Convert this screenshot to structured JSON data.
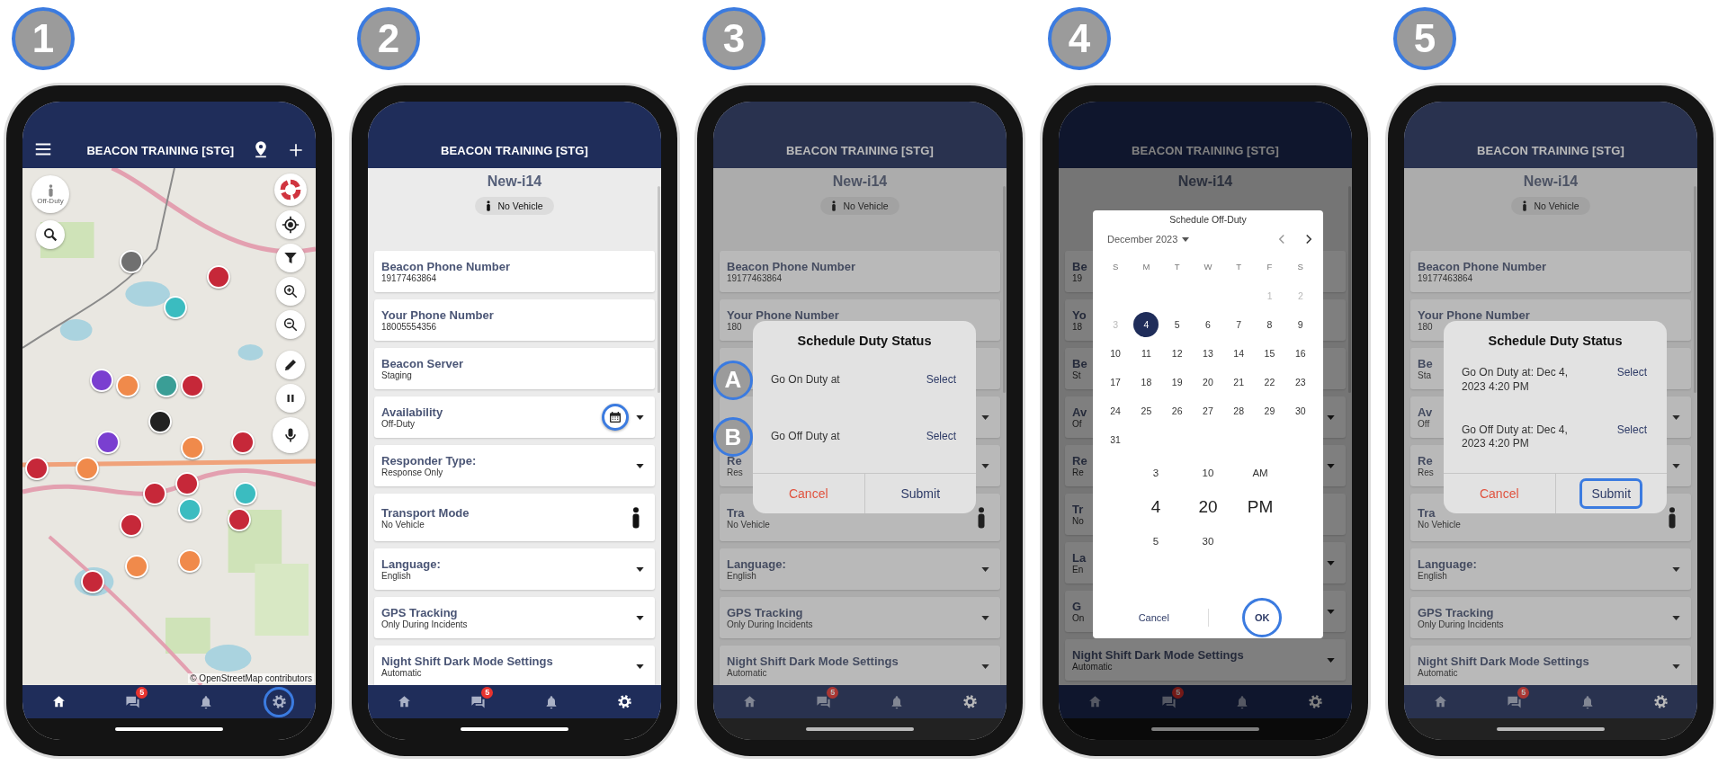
{
  "steps": [
    {
      "number": "1",
      "screen": {
        "kind": "map",
        "header": {
          "title": "BEACON TRAINING [STG]"
        },
        "duty_button": {
          "label": "Off-Duty"
        },
        "markers": [
          {
            "color": "#707070"
          },
          {
            "color": "#c62839"
          },
          {
            "color": "#3bbcc0"
          },
          {
            "color": "#7a3fd0"
          },
          {
            "color": "#f08a4b"
          },
          {
            "color": "#3a9e96"
          },
          {
            "color": "#c62839"
          },
          {
            "color": "#222222"
          },
          {
            "color": "#7a3fd0"
          },
          {
            "color": "#f08a4b"
          },
          {
            "color": "#c62839"
          },
          {
            "color": "#c62839"
          },
          {
            "color": "#f08a4b"
          },
          {
            "color": "#c62839"
          },
          {
            "color": "#c62839"
          },
          {
            "color": "#3bbcc0"
          },
          {
            "color": "#3bbcc0"
          },
          {
            "color": "#c62839"
          },
          {
            "color": "#c62839"
          },
          {
            "color": "#f08a4b"
          },
          {
            "color": "#f08a4b"
          },
          {
            "color": "#c62839"
          }
        ],
        "attribution": "© OpenStreetMap contributors",
        "nav": [
          {
            "kind": "home",
            "selected": true,
            "highlighted": false
          },
          {
            "kind": "chat",
            "badge": "5",
            "selected": false,
            "highlighted": false
          },
          {
            "kind": "bell",
            "selected": false,
            "highlighted": false
          },
          {
            "kind": "gear",
            "selected": false,
            "highlighted": true
          }
        ]
      }
    },
    {
      "number": "2",
      "screen": {
        "kind": "settings",
        "header": {
          "title": "BEACON TRAINING [STG]"
        },
        "device": {
          "name": "New-i14",
          "chip": "No Vehicle"
        },
        "items": [
          {
            "title": "Beacon Phone Number",
            "value": "19177463864",
            "kind": "plain"
          },
          {
            "title": "Your Phone Number",
            "value": "18005554356",
            "kind": "plain"
          },
          {
            "title": "Beacon Server",
            "value": "Staging",
            "kind": "plain"
          },
          {
            "title": "Availability",
            "value": "Off-Duty",
            "kind": "calendar",
            "highlighted": true
          },
          {
            "title": "Responder Type:",
            "value": "Response Only",
            "kind": "caret"
          },
          {
            "title": "Transport Mode",
            "value": "No Vehicle",
            "kind": "person"
          },
          {
            "title": "Language:",
            "value": "English",
            "kind": "caret"
          },
          {
            "title": "GPS Tracking",
            "value": "Only During Incidents",
            "kind": "caret"
          },
          {
            "title": "Night Shift Dark Mode Settings",
            "value": "Automatic",
            "kind": "caret"
          }
        ],
        "nav": [
          {
            "kind": "home",
            "selected": false,
            "highlighted": false
          },
          {
            "kind": "chat",
            "badge": "5",
            "selected": false,
            "highlighted": false
          },
          {
            "kind": "bell",
            "selected": false,
            "highlighted": false
          },
          {
            "kind": "gear",
            "selected": true,
            "highlighted": false
          }
        ]
      }
    },
    {
      "number": "3",
      "screen": {
        "kind": "settings",
        "header": {
          "title": "BEACON TRAINING [STG]"
        },
        "device": {
          "name": "New-i14",
          "chip": "No Vehicle"
        },
        "items": [
          {
            "title": "Beacon Phone Number",
            "value": "19177463864",
            "kind": "plain"
          },
          {
            "title": "Your Phone Number",
            "value": "180",
            "kind": "plain"
          },
          {
            "kind": "plain"
          },
          {
            "kind": "caret"
          },
          {
            "title": "Re",
            "value": "Res",
            "kind": "caret"
          },
          {
            "title": "Tra",
            "value": "No Vehicle",
            "kind": "person"
          },
          {
            "title": "Language:",
            "value": "English",
            "kind": "caret"
          },
          {
            "title": "GPS Tracking",
            "value": "Only During Incidents",
            "kind": "caret"
          },
          {
            "title": "Night Shift Dark Mode Settings",
            "value": "Automatic",
            "kind": "caret"
          }
        ],
        "dialog": {
          "kind": "schedule",
          "title": "Schedule Duty Status",
          "rows": [
            {
              "label": "Go On Duty at",
              "action": "Select",
              "marker": "A"
            },
            {
              "label": "Go Off Duty at",
              "action": "Select",
              "marker": "B"
            }
          ],
          "buttons": [
            {
              "label": "Cancel",
              "kind": "cancel",
              "highlighted": false
            },
            {
              "label": "Submit",
              "kind": "submit",
              "highlighted": false
            }
          ]
        },
        "nav": [
          {
            "kind": "home",
            "selected": false,
            "highlighted": false
          },
          {
            "kind": "chat",
            "badge": "5",
            "selected": false,
            "highlighted": false
          },
          {
            "kind": "bell",
            "selected": false,
            "highlighted": false
          },
          {
            "kind": "gear",
            "selected": true,
            "highlighted": false
          }
        ]
      }
    },
    {
      "number": "4",
      "screen": {
        "kind": "settings",
        "header": {
          "title": "BEACON TRAINING [STG]"
        },
        "device": {
          "name": "New-i14"
        },
        "items": [
          {
            "title": "Be",
            "value": "19",
            "kind": "plain"
          },
          {
            "title": "Yo",
            "value": "18",
            "kind": "plain"
          },
          {
            "title": "Be",
            "value": "St",
            "kind": "plain"
          },
          {
            "title": "Av",
            "value": "Of",
            "kind": "caret"
          },
          {
            "title": "Re",
            "value": "Re",
            "kind": "caret"
          },
          {
            "title": "Tr",
            "value": "No",
            "kind": "plain"
          },
          {
            "title": "La",
            "value": "En",
            "kind": "caret"
          },
          {
            "title": "G",
            "value": "On",
            "kind": "caret"
          },
          {
            "title": "Night Shift Dark Mode Settings",
            "value": "Automatic",
            "kind": "caret"
          }
        ],
        "dialog": {
          "kind": "date_picker",
          "title": "Schedule Off-Duty",
          "month": "December 2023",
          "weekdays": [
            "S",
            "M",
            "T",
            "W",
            "T",
            "F",
            "S"
          ],
          "weeks": [
            {
              "days": [
                {
                  "label": "1",
                  "selected": false,
                  "disabled": true
                },
                {
                  "label": "2",
                  "selected": false,
                  "disabled": true
                }
              ]
            },
            {
              "days": [
                {
                  "label": "3",
                  "selected": false,
                  "disabled": true
                },
                {
                  "label": "4",
                  "selected": true,
                  "disabled": false
                },
                {
                  "label": "5",
                  "selected": false,
                  "disabled": false
                },
                {
                  "label": "6",
                  "selected": false,
                  "disabled": false
                },
                {
                  "label": "7",
                  "selected": false,
                  "disabled": false
                },
                {
                  "label": "8",
                  "selected": false,
                  "disabled": false
                },
                {
                  "label": "9",
                  "selected": false,
                  "disabled": false
                }
              ]
            },
            {
              "days": [
                {
                  "label": "10",
                  "selected": false,
                  "disabled": false
                },
                {
                  "label": "11",
                  "selected": false,
                  "disabled": false
                },
                {
                  "label": "12",
                  "selected": false,
                  "disabled": false
                },
                {
                  "label": "13",
                  "selected": false,
                  "disabled": false
                },
                {
                  "label": "14",
                  "selected": false,
                  "disabled": false
                },
                {
                  "label": "15",
                  "selected": false,
                  "disabled": false
                },
                {
                  "label": "16",
                  "selected": false,
                  "disabled": false
                }
              ]
            },
            {
              "days": [
                {
                  "label": "17",
                  "selected": false,
                  "disabled": false
                },
                {
                  "label": "18",
                  "selected": false,
                  "disabled": false
                },
                {
                  "label": "19",
                  "selected": false,
                  "disabled": false
                },
                {
                  "label": "20",
                  "selected": false,
                  "disabled": false
                },
                {
                  "label": "21",
                  "selected": false,
                  "disabled": false
                },
                {
                  "label": "22",
                  "selected": false,
                  "disabled": false
                },
                {
                  "label": "23",
                  "selected": false,
                  "disabled": false
                }
              ]
            },
            {
              "days": [
                {
                  "label": "24",
                  "selected": false,
                  "disabled": false
                },
                {
                  "label": "25",
                  "selected": false,
                  "disabled": false
                },
                {
                  "label": "26",
                  "selected": false,
                  "disabled": false
                },
                {
                  "label": "27",
                  "selected": false,
                  "disabled": false
                },
                {
                  "label": "28",
                  "selected": false,
                  "disabled": false
                },
                {
                  "label": "29",
                  "selected": false,
                  "disabled": false
                },
                {
                  "label": "30",
                  "selected": false,
                  "disabled": false
                }
              ]
            },
            {
              "days": [
                {
                  "label": "31",
                  "selected": false,
                  "disabled": false
                }
              ]
            }
          ],
          "wheels": [
            {
              "options": [
                {
                  "label": "3",
                  "selected": false
                },
                {
                  "label": "4",
                  "selected": true
                },
                {
                  "label": "5",
                  "selected": false
                }
              ]
            },
            {
              "options": [
                {
                  "label": "10",
                  "selected": false
                },
                {
                  "label": "20",
                  "selected": true
                },
                {
                  "label": "30",
                  "selected": false
                }
              ]
            },
            {
              "options": [
                {
                  "label": "AM",
                  "selected": false
                },
                {
                  "label": "PM",
                  "selected": true
                }
              ]
            }
          ],
          "buttons": [
            {
              "label": "Cancel",
              "kind": "cancel",
              "highlighted": false
            },
            {
              "label": "OK",
              "kind": "submit",
              "highlighted": true
            }
          ]
        },
        "nav": [
          {
            "kind": "home",
            "selected": false,
            "highlighted": false
          },
          {
            "kind": "chat",
            "badge": "5",
            "selected": false,
            "highlighted": false
          },
          {
            "kind": "bell",
            "selected": false,
            "highlighted": false
          },
          {
            "kind": "gear",
            "selected": true,
            "highlighted": false
          }
        ]
      }
    },
    {
      "number": "5",
      "screen": {
        "kind": "settings",
        "header": {
          "title": "BEACON TRAINING [STG]"
        },
        "device": {
          "name": "New-i14",
          "chip": "No Vehicle"
        },
        "items": [
          {
            "title": "Beacon Phone Number",
            "value": "19177463864",
            "kind": "plain"
          },
          {
            "title": "Your Phone Number",
            "value": "180",
            "kind": "plain"
          },
          {
            "title": "Be",
            "value": "Sta",
            "kind": "plain"
          },
          {
            "title": "Av",
            "value": "Off",
            "kind": "caret"
          },
          {
            "title": "Re",
            "value": "Res",
            "kind": "caret"
          },
          {
            "title": "Tra",
            "value": "No Vehicle",
            "kind": "person"
          },
          {
            "title": "Language:",
            "value": "English",
            "kind": "caret"
          },
          {
            "title": "GPS Tracking",
            "value": "Only During Incidents",
            "kind": "caret"
          },
          {
            "title": "Night Shift Dark Mode Settings",
            "value": "Automatic",
            "kind": "caret"
          }
        ],
        "dialog": {
          "kind": "schedule",
          "title": "Schedule Duty Status",
          "rows": [
            {
              "label": "Go On Duty at: Dec 4, 2023 4:20 PM",
              "action": "Select"
            },
            {
              "label": "Go Off Duty at: Dec 4, 2023 4:20 PM",
              "action": "Select"
            }
          ],
          "buttons": [
            {
              "label": "Cancel",
              "kind": "cancel",
              "highlighted": false
            },
            {
              "label": "Submit",
              "kind": "submit",
              "highlighted": true
            }
          ]
        },
        "nav": [
          {
            "kind": "home",
            "selected": false,
            "highlighted": false
          },
          {
            "kind": "chat",
            "badge": "5",
            "selected": false,
            "highlighted": false
          },
          {
            "kind": "bell",
            "selected": false,
            "highlighted": false
          },
          {
            "kind": "gear",
            "selected": true,
            "highlighted": false
          }
        ]
      }
    }
  ]
}
